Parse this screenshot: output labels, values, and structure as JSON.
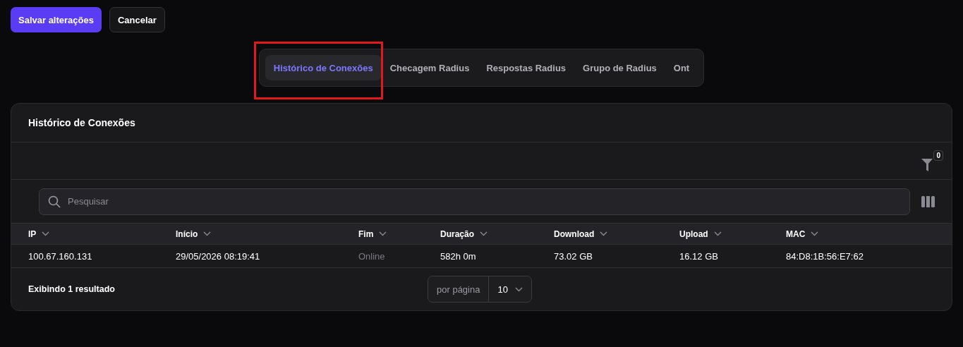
{
  "actions": [
    {
      "label": "Salvar alterações",
      "kind": "primary"
    },
    {
      "label": "Cancelar",
      "kind": "secondary"
    }
  ],
  "tabs": [
    {
      "label": "Histórico de Conexões",
      "selected": true,
      "highlighted": true
    },
    {
      "label": "Checagem Radius",
      "selected": false,
      "highlighted": false
    },
    {
      "label": "Respostas Radius",
      "selected": false,
      "highlighted": false
    },
    {
      "label": "Grupo de Radius",
      "selected": false,
      "highlighted": false
    },
    {
      "label": "Ont",
      "selected": false,
      "highlighted": false
    }
  ],
  "card": {
    "title": "Histórico de Conexões",
    "filter_count": "0",
    "search": {
      "placeholder": "Pesquisar"
    }
  },
  "table": {
    "columns": [
      "IP",
      "Início",
      "Fim",
      "Duração",
      "Download",
      "Upload",
      "MAC"
    ],
    "rows": [
      [
        {
          "text": "100.67.160.131",
          "muted": false
        },
        {
          "text": "29/05/2026 08:19:41",
          "muted": false
        },
        {
          "text": "Online",
          "muted": true
        },
        {
          "text": "582h 0m",
          "muted": false
        },
        {
          "text": "73.02 GB",
          "muted": false
        },
        {
          "text": "16.12 GB",
          "muted": false
        },
        {
          "text": "84:D8:1B:56:E7:62",
          "muted": false
        }
      ]
    ]
  },
  "footer": {
    "summary": "Exibindo 1 resultado",
    "per_page_label": "por página",
    "per_page": "10"
  }
}
